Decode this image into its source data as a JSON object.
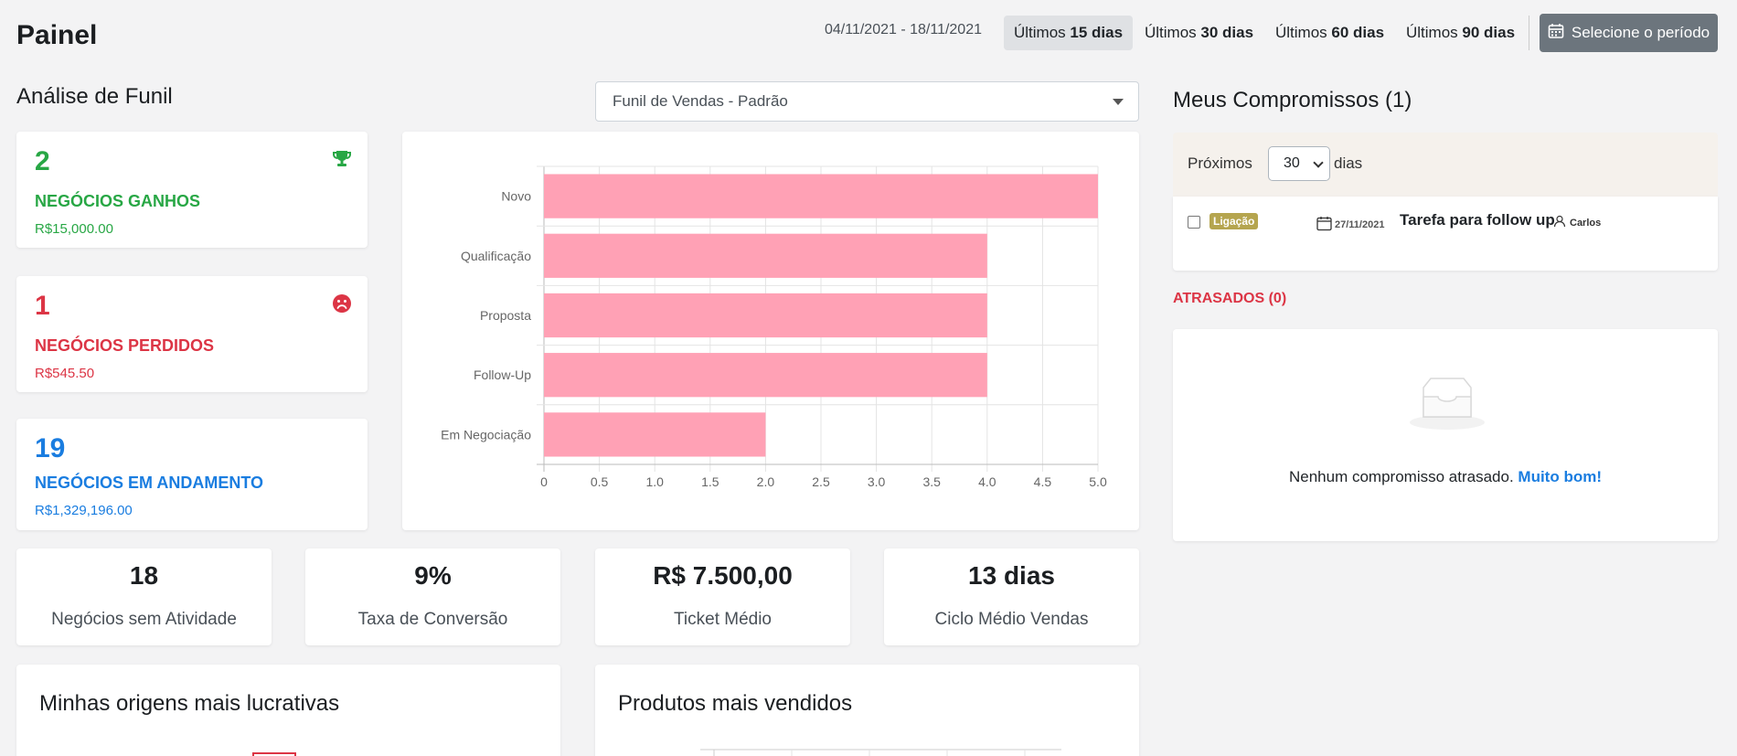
{
  "header": {
    "title": "Painel",
    "date_range": "04/11/2021 - 18/11/2021",
    "periods": [
      {
        "prefix": "Últimos",
        "bold": "15 dias"
      },
      {
        "prefix": "Últimos",
        "bold": "30 dias"
      },
      {
        "prefix": "Últimos",
        "bold": "60 dias"
      },
      {
        "prefix": "Últimos",
        "bold": "90 dias"
      }
    ],
    "active_period_index": 0,
    "select_period_label": "Selecione o período"
  },
  "funnel": {
    "title": "Análise de Funil",
    "select_value": "Funil de Vendas - Padrão",
    "won": {
      "count": "2",
      "label": "NEGÓCIOS GANHOS",
      "amount": "R$15,000.00",
      "icon": "trophy-icon"
    },
    "lost": {
      "count": "1",
      "label": "NEGÓCIOS PERDIDOS",
      "amount": "R$545.50",
      "icon": "sad-face-icon"
    },
    "ongoing": {
      "count": "19",
      "label": "NEGÓCIOS EM ANDAMENTO",
      "amount": "R$1,329,196.00"
    }
  },
  "chart_data": {
    "type": "bar",
    "orientation": "horizontal",
    "categories": [
      "Novo",
      "Qualificação",
      "Proposta",
      "Follow-Up",
      "Em Negociação"
    ],
    "values": [
      5,
      4,
      4,
      4,
      2
    ],
    "x_ticks": [
      "0",
      "0.5",
      "1.0",
      "1.5",
      "2.0",
      "2.5",
      "3.0",
      "3.5",
      "4.0",
      "4.5",
      "5.0"
    ],
    "xlim": [
      0,
      5
    ],
    "grid": true,
    "bar_color": "#ffa1b5"
  },
  "kpis": [
    {
      "value": "18",
      "label": "Negócios sem Atividade"
    },
    {
      "value": "9%",
      "label": "Taxa de Conversão"
    },
    {
      "value": "R$ 7.500,00",
      "label": "Ticket Médio"
    },
    {
      "value": "13 dias",
      "label": "Ciclo Médio Vendas"
    }
  ],
  "bottom": {
    "origins_title": "Minhas origens mais lucrativas",
    "products_title": "Produtos mais vendidos"
  },
  "commitments": {
    "title": "Meus Compromissos (1)",
    "proximos_label": "Próximos",
    "days_value": "30",
    "days_suffix": "dias",
    "task": {
      "badge": "Ligação",
      "date": "27/11/2021",
      "name": "Tarefa para follow up",
      "user": "Carlos"
    },
    "late_title": "ATRASADOS (0)",
    "empty_message": "Nenhum compromisso atrasado.",
    "empty_link": "Muito bom!"
  },
  "colors": {
    "green": "#28a745",
    "red": "#dc3545",
    "blue": "#1a7de0",
    "bar": "#ffa1b5",
    "badge": "#b5a54f",
    "select_period_bg": "#6c757d"
  }
}
